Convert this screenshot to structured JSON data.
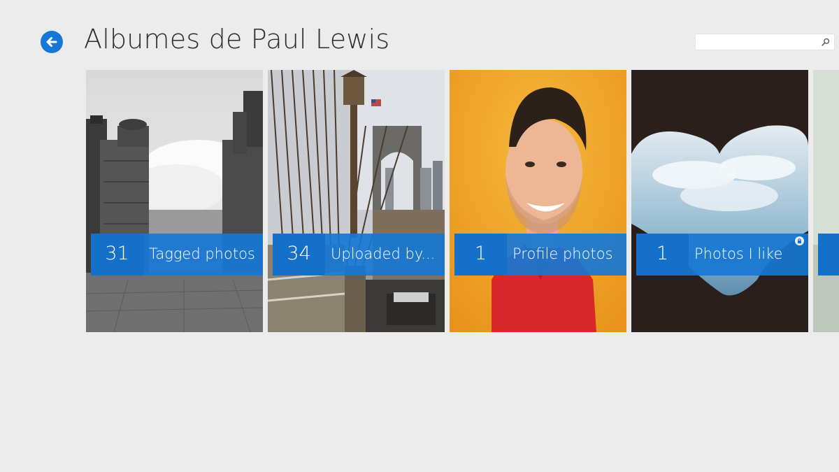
{
  "header": {
    "title": "Albumes de Paul Lewis",
    "back_icon": "back-arrow-icon"
  },
  "search": {
    "value": "",
    "placeholder": "",
    "icon": "search-icon"
  },
  "colors": {
    "accent": "#1777d4",
    "background": "#ececec"
  },
  "albums": [
    {
      "count": "31",
      "name": "Tagged photos",
      "photo": "black-and-white city buildings"
    },
    {
      "count": "34",
      "name": "Uploaded by...",
      "photo": "bridge with cables and lamp post"
    },
    {
      "count": "1",
      "name": "Profile photos",
      "photo": "smiling man in red shirt"
    },
    {
      "count": "1",
      "name": "Photos I like",
      "photo": "heart-shaped sky cutout",
      "private_icon": "lock-icon"
    }
  ]
}
